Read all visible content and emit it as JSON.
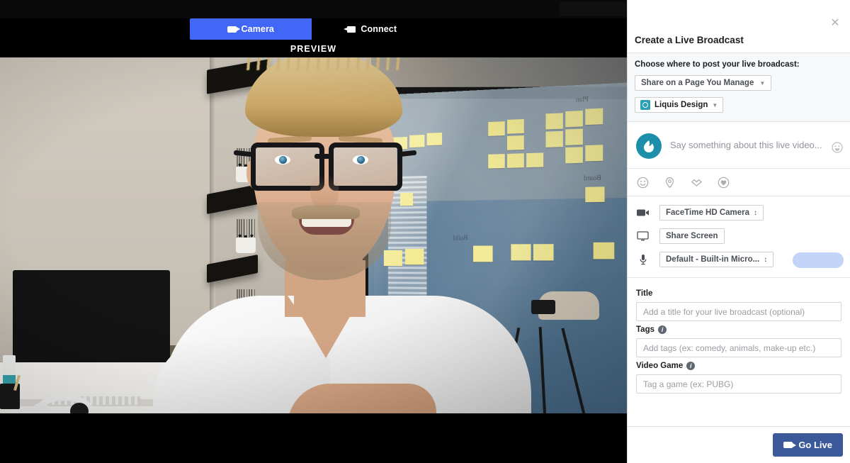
{
  "stage": {
    "tabs": [
      {
        "label": "Camera",
        "icon": "video-camera-icon",
        "active": true
      },
      {
        "label": "Connect",
        "icon": "plug-icon",
        "active": false
      }
    ],
    "preview_label": "PREVIEW",
    "accent_blue": "#4267f6"
  },
  "panel": {
    "title": "Create a Live Broadcast",
    "close_icon": "close-icon",
    "post_section": {
      "label": "Choose where to post your live broadcast:",
      "destination": "Share on a Page You Manage",
      "page": "Liquis Design"
    },
    "composer": {
      "placeholder": "Say something about this live video...",
      "avatar_icon": "page-avatar-icon",
      "emoji_icon": "emoji-picker-icon",
      "actions": [
        {
          "name": "feeling-activity-icon",
          "label": "Feeling/Activity"
        },
        {
          "name": "check-in-location-icon",
          "label": "Check in"
        },
        {
          "name": "tag-friends-icon",
          "label": "Tag Friends"
        },
        {
          "name": "support-cause-icon",
          "label": "Support Nonprofit"
        }
      ]
    },
    "devices": [
      {
        "icon": "video-camera-icon",
        "type": "select",
        "value": "FaceTime HD Camera"
      },
      {
        "icon": "screen-share-icon",
        "type": "button",
        "value": "Share Screen"
      },
      {
        "icon": "microphone-icon",
        "type": "select",
        "value": "Default - Built-in Micro...",
        "meter": true
      }
    ],
    "fields": [
      {
        "label": "Title",
        "info": false,
        "placeholder": "Add a title for your live broadcast (optional)",
        "value": ""
      },
      {
        "label": "Tags",
        "info": true,
        "placeholder": "Add tags (ex: comedy, animals, make-up etc.)",
        "value": ""
      },
      {
        "label": "Video Game",
        "info": true,
        "placeholder": "Tag a game (ex: PUBG)",
        "value": ""
      }
    ],
    "footer": {
      "go_live_label": "Go Live",
      "go_live_icon": "video-camera-icon",
      "go_live_color": "#3b5998"
    }
  }
}
